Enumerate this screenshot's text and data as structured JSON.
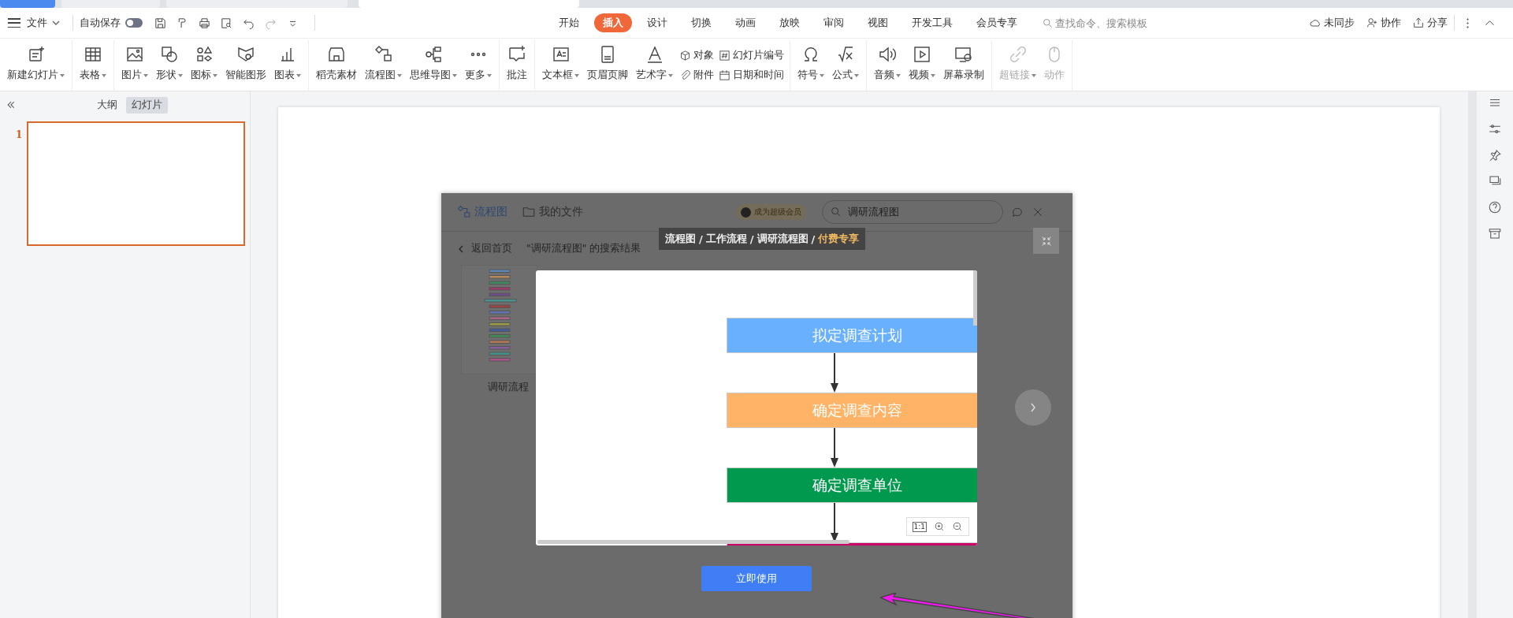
{
  "document_tabs": [
    {
      "kind": "home",
      "selected": false
    },
    {
      "kind": "document",
      "selected": false
    },
    {
      "kind": "document",
      "selected": false
    },
    {
      "kind": "document",
      "selected": true
    }
  ],
  "menu_bar": {
    "file_menu": "文件",
    "autosave": {
      "label": "自动保存",
      "on": false
    },
    "tabs": [
      {
        "label": "开始",
        "selected": false
      },
      {
        "label": "插入",
        "selected": true
      },
      {
        "label": "设计",
        "selected": false
      },
      {
        "label": "切换",
        "selected": false
      },
      {
        "label": "动画",
        "selected": false
      },
      {
        "label": "放映",
        "selected": false
      },
      {
        "label": "审阅",
        "selected": false
      },
      {
        "label": "视图",
        "selected": false
      },
      {
        "label": "开发工具",
        "selected": false
      },
      {
        "label": "会员专享",
        "selected": false
      }
    ],
    "search": {
      "placeholder": "查找命令、搜索模板"
    },
    "actions": [
      "未同步",
      "协作",
      "分享"
    ]
  },
  "ribbon": {
    "groups": [
      [
        {
          "kind": "large",
          "label": "新建幻灯片",
          "dropdown": true,
          "disabled": false
        }
      ],
      [
        {
          "kind": "large",
          "label": "表格",
          "dropdown": true,
          "disabled": false
        }
      ],
      [
        {
          "kind": "large",
          "label": "图片",
          "dropdown": true,
          "disabled": false
        },
        {
          "kind": "large",
          "label": "形状",
          "dropdown": true,
          "disabled": false
        },
        {
          "kind": "large",
          "label": "图标",
          "dropdown": true,
          "disabled": false
        },
        {
          "kind": "large",
          "label": "智能图形",
          "dropdown": false,
          "disabled": false
        },
        {
          "kind": "large",
          "label": "图表",
          "dropdown": true,
          "disabled": false
        }
      ],
      [
        {
          "kind": "large",
          "label": "稻壳素材",
          "dropdown": false,
          "disabled": false
        },
        {
          "kind": "large",
          "label": "流程图",
          "dropdown": true,
          "disabled": false
        },
        {
          "kind": "large",
          "label": "思维导图",
          "dropdown": true,
          "disabled": false
        },
        {
          "kind": "large",
          "label": "更多",
          "dropdown": true,
          "disabled": false
        }
      ],
      [
        {
          "kind": "large",
          "label": "批注",
          "dropdown": false,
          "disabled": false
        }
      ],
      [
        {
          "kind": "large",
          "label": "文本框",
          "dropdown": true,
          "disabled": false
        },
        {
          "kind": "large",
          "label": "页眉页脚",
          "dropdown": false,
          "disabled": false
        },
        {
          "kind": "large",
          "label": "艺术字",
          "dropdown": true,
          "disabled": false
        },
        {
          "kind": "stack",
          "items": [
            "对象",
            "附件"
          ]
        },
        {
          "kind": "stack",
          "items": [
            "幻灯片编号",
            "日期和时间"
          ]
        }
      ],
      [
        {
          "kind": "large",
          "label": "符号",
          "dropdown": true,
          "disabled": false
        },
        {
          "kind": "large",
          "label": "公式",
          "dropdown": true,
          "disabled": false
        }
      ],
      [
        {
          "kind": "large",
          "label": "音频",
          "dropdown": true,
          "disabled": false
        },
        {
          "kind": "large",
          "label": "视频",
          "dropdown": true,
          "disabled": false
        },
        {
          "kind": "large",
          "label": "屏幕录制",
          "dropdown": false,
          "disabled": false
        }
      ],
      [
        {
          "kind": "large",
          "label": "超链接",
          "dropdown": true,
          "disabled": true
        },
        {
          "kind": "large",
          "label": "动作",
          "dropdown": false,
          "disabled": true
        }
      ]
    ]
  },
  "left_panel": {
    "view_tabs": [
      {
        "label": "大纲",
        "selected": false
      },
      {
        "label": "幻灯片",
        "selected": true
      }
    ],
    "slides": [
      {
        "number": "1",
        "selected": true
      }
    ]
  },
  "dialog": {
    "tabs": [
      {
        "label": "流程图",
        "selected": true
      },
      {
        "label": "我的文件",
        "selected": false
      }
    ],
    "member_badge": "成为超级会员",
    "search": {
      "value": "调研流程图"
    },
    "back": "返回首页",
    "results_label": "\"调研流程图\" 的搜索结果",
    "results": [
      {
        "caption": "调研流程"
      }
    ],
    "breadcrumb": {
      "parts": [
        "流程图",
        "工作流程",
        "调研流程图"
      ],
      "separator": "/",
      "paid": "付费专享"
    },
    "preview": {
      "nodes": [
        {
          "label": "拟定调查计划",
          "color": "#69b1ff"
        },
        {
          "label": "确定调查内容",
          "color": "#ffb366"
        },
        {
          "label": "确定调查单位",
          "color": "#00994d"
        },
        {
          "color": "#cc0066"
        }
      ],
      "zoom_reset": "1:1"
    },
    "use_button": "立即使用"
  }
}
